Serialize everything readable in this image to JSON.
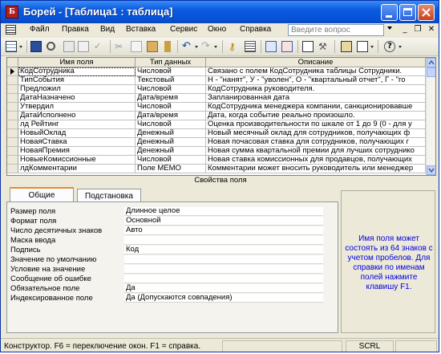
{
  "window": {
    "title": "Борей - [Таблица1 : таблица]",
    "app_icon_letter": "Б"
  },
  "menu": {
    "items": [
      "Файл",
      "Правка",
      "Вид",
      "Вставка",
      "Сервис",
      "Окно",
      "Справка"
    ],
    "help_placeholder": "Введите вопрос",
    "mdi_buttons": [
      "_",
      "❐",
      "✕"
    ]
  },
  "grid": {
    "columns": [
      "Имя поля",
      "Тип данных",
      "Описание"
    ],
    "rows": [
      {
        "name": "КодСотрудника",
        "type": "Числовой",
        "desc": "Связано с полем КодСотрудника таблицы Сотрудники."
      },
      {
        "name": "ТипСобытия",
        "type": "Текстовый",
        "desc": "Н - \"нанят\", У - \"уволен\", О - \"квартальный отчет\", Г - \"го"
      },
      {
        "name": "Предложил",
        "type": "Числовой",
        "desc": "КодСотрудника руководителя."
      },
      {
        "name": "ДатаНазначено",
        "type": "Дата/время",
        "desc": "Запланированная дата"
      },
      {
        "name": "Утвердил",
        "type": "Числовой",
        "desc": "КодСотрудника менеджера компании, санкционировавше"
      },
      {
        "name": "ДатаИсполнено",
        "type": "Дата/время",
        "desc": "Дата, когда событие реально произошло."
      },
      {
        "name": "лд Рейтинг",
        "type": "Числовой",
        "desc": "Оценка производительности по шкале от 1 до 9 (0 - для у"
      },
      {
        "name": "НовыйОклад",
        "type": "Денежный",
        "desc": "Новый месячный оклад для сотрудников, получающих ф"
      },
      {
        "name": "НоваяСтавка",
        "type": "Денежный",
        "desc": "Новая почасовая ставка для сотрудников, получающих г"
      },
      {
        "name": "НоваяПремия",
        "type": "Денежный",
        "desc": "Новая сумма квартальной премии для лучших сотруднико"
      },
      {
        "name": "НовыеКомиссионные",
        "type": "Числовой",
        "desc": "Новая ставка комиссионных для продавцов, получающих"
      },
      {
        "name": "лдКомментарии",
        "type": "Поле MEMO",
        "desc": "Комментарии может вносить руководитель или менеджер"
      }
    ]
  },
  "properties": {
    "caption": "Свойства поля",
    "tabs": [
      "Общие",
      "Подстановка"
    ],
    "rows": [
      {
        "label": "Размер поля",
        "value": "Длинное целое"
      },
      {
        "label": "Формат поля",
        "value": "Основной"
      },
      {
        "label": "Число десятичных знаков",
        "value": "Авто"
      },
      {
        "label": "Маска ввода",
        "value": ""
      },
      {
        "label": "Подпись",
        "value": "Код"
      },
      {
        "label": "Значение по умолчанию",
        "value": ""
      },
      {
        "label": "Условие на значение",
        "value": ""
      },
      {
        "label": "Сообщение об ошибке",
        "value": ""
      },
      {
        "label": "Обязательное поле",
        "value": "Да"
      },
      {
        "label": "Индексированное поле",
        "value": "Да (Допускаются совпадения)"
      }
    ],
    "help": "Имя поля может состоять из 64 знаков с учетом пробелов.  Для справки по именам полей нажмите клавишу F1."
  },
  "status": {
    "text": "Конструктор.  F6 = переключение окон.  F1 = справка.",
    "mode": "SCRL"
  }
}
